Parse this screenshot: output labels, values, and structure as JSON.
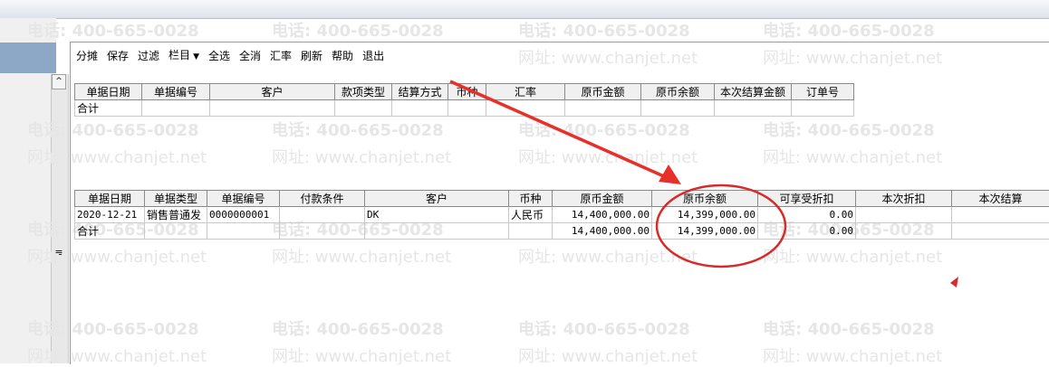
{
  "watermark": {
    "phone": "电话: 400-665-0028",
    "site": "网址: www.chanjet.net"
  },
  "toolbar": {
    "buttons": [
      "分摊",
      "保存",
      "过滤",
      "栏目",
      "全选",
      "全消",
      "汇率",
      "刷新",
      "帮助",
      "退出"
    ],
    "dropdown_arrow": "▼"
  },
  "scroll": {
    "up": "^",
    "grip": "≡"
  },
  "top_grid": {
    "headers": [
      "单据日期",
      "单据编号",
      "客户",
      "款项类型",
      "结算方式",
      "币种",
      "汇率",
      "原币金额",
      "原币余额",
      "本次结算金额",
      "订单号"
    ],
    "total_label": "合计"
  },
  "bottom_grid": {
    "headers": [
      "单据日期",
      "单据类型",
      "单据编号",
      "付款条件",
      "客户",
      "币种",
      "原币金额",
      "原币余额",
      "可享受折扣",
      "本次折扣",
      "本次结算"
    ],
    "rows": [
      {
        "date": "2020-12-21",
        "type": "销售普通发",
        "number": "0000000001",
        "terms": "",
        "customer": "DK",
        "currency": "人民币",
        "amount": "14,400,000.00",
        "balance": "14,399,000.00",
        "discount": "0.00",
        "cur_discount": "",
        "settle": ""
      }
    ],
    "total": {
      "label": "合计",
      "amount": "14,400,000.00",
      "balance": "14,399,000.00",
      "discount": "0.00"
    }
  },
  "annotation": {
    "arrow_color": "#e8302a",
    "circle_color": "#d92a2a"
  }
}
